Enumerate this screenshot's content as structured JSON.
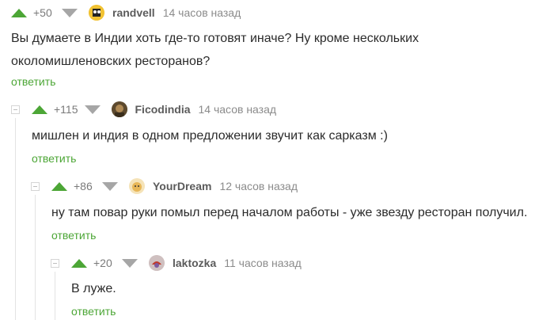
{
  "comments": [
    {
      "rating": "+50",
      "author": "randvell",
      "time": "14 часов назад",
      "text": "Вы думаете в Индии хоть где-то готовят иначе? Ну кроме нескольких околомишленовских ресторанов?",
      "reply": "ответить"
    },
    {
      "rating": "+115",
      "author": "Ficodindia",
      "time": "14 часов назад",
      "text": "мишлен и индия в одном предложении звучит как сарказм :)",
      "reply": "ответить"
    },
    {
      "rating": "+86",
      "author": "YourDream",
      "time": "12 часов назад",
      "text": "ну там повар руки помыл перед началом работы - уже звезду ресторан получил.",
      "reply": "ответить"
    },
    {
      "rating": "+20",
      "author": "laktozka",
      "time": "11 часов назад",
      "text": "В луже.",
      "reply": "ответить"
    }
  ],
  "colors": {
    "accent": "#4ca636",
    "downvote": "#a6a6a6",
    "meta": "#8b8b8b"
  }
}
